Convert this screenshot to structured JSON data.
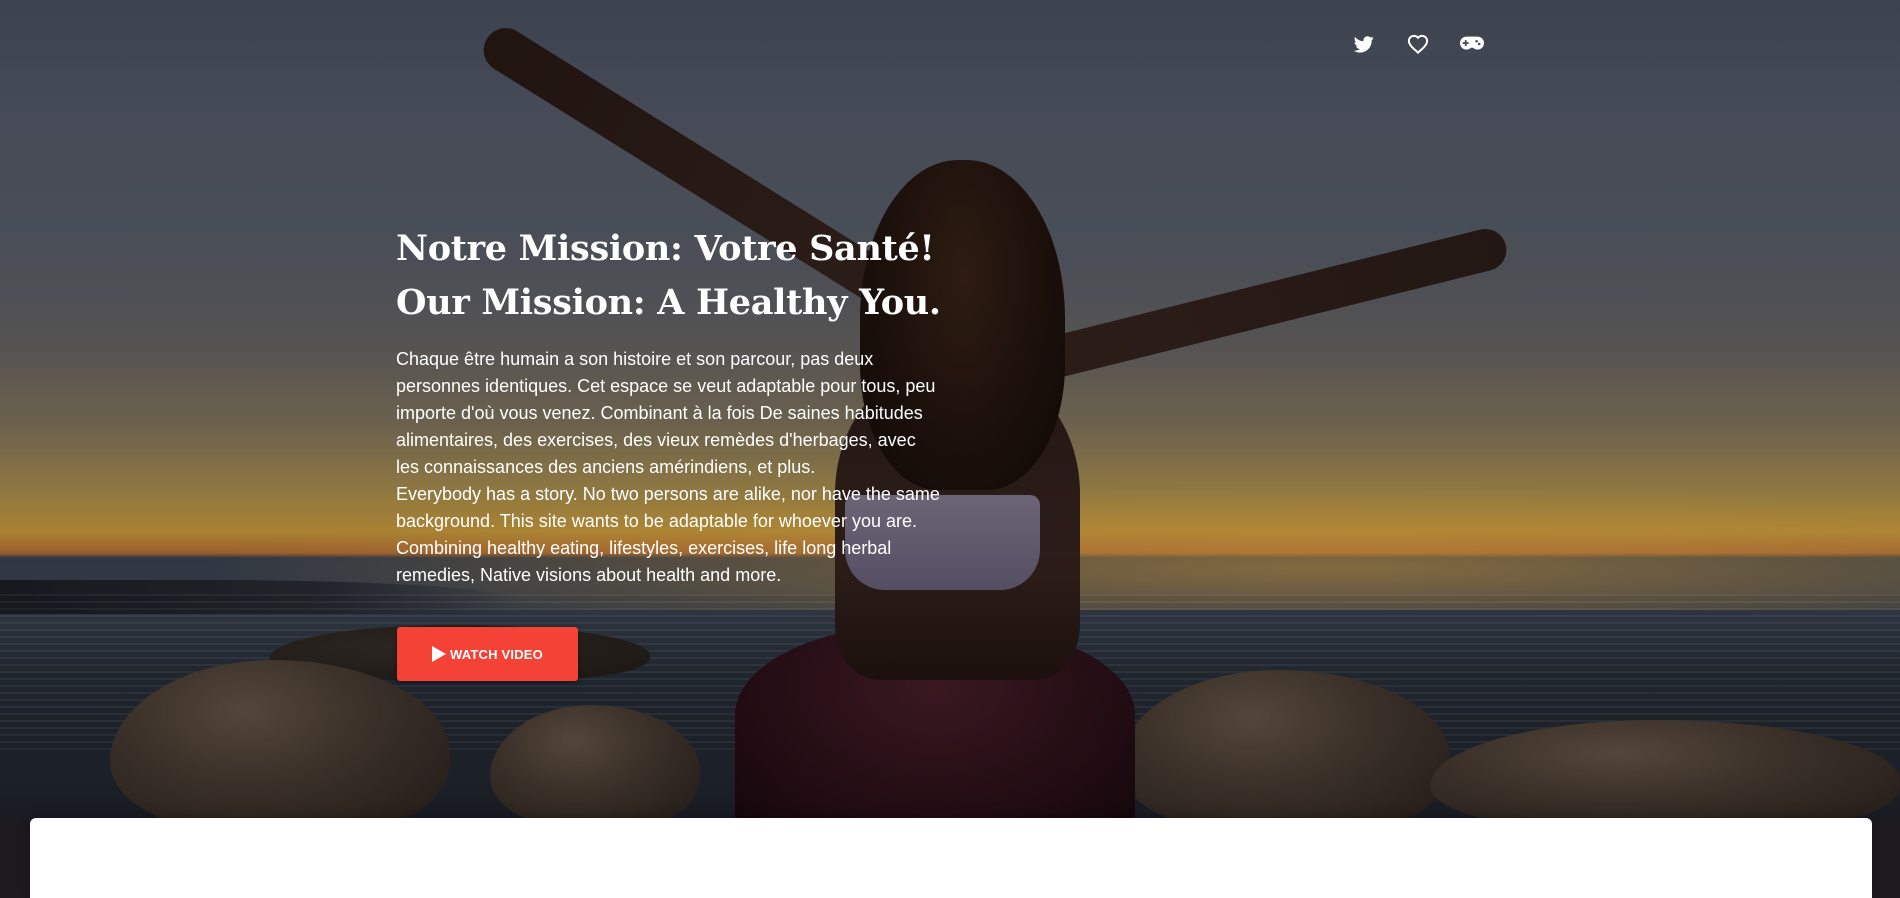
{
  "social": {
    "twitter_icon": "twitter-icon",
    "heart_icon": "heart-icon",
    "gamepad_icon": "gamepad-icon"
  },
  "hero": {
    "title_fr": "Notre Mission: Votre Santé!",
    "title_en": "Our Mission: A Healthy You.",
    "desc_fr": "Chaque être humain a son histoire et son parcour, pas deux personnes identiques. Cet espace se veut adaptable pour tous, peu importe d'où vous venez. Combinant à la fois De saines habitudes alimentaires, des exercises, des vieux remèdes d'herbages, avec les connaissances des anciens amérindiens, et plus.",
    "desc_en": "Everybody has a story. No two persons are alike, nor have the same background. This site wants to be adaptable for whoever you are. Combining healthy eating, lifestyles, exercises, life long herbal remedies, Native visions about health and more.",
    "watch_label": "WATCH VIDEO"
  },
  "colors": {
    "accent": "#f44336",
    "text": "#ffffff",
    "card": "#ffffff"
  }
}
